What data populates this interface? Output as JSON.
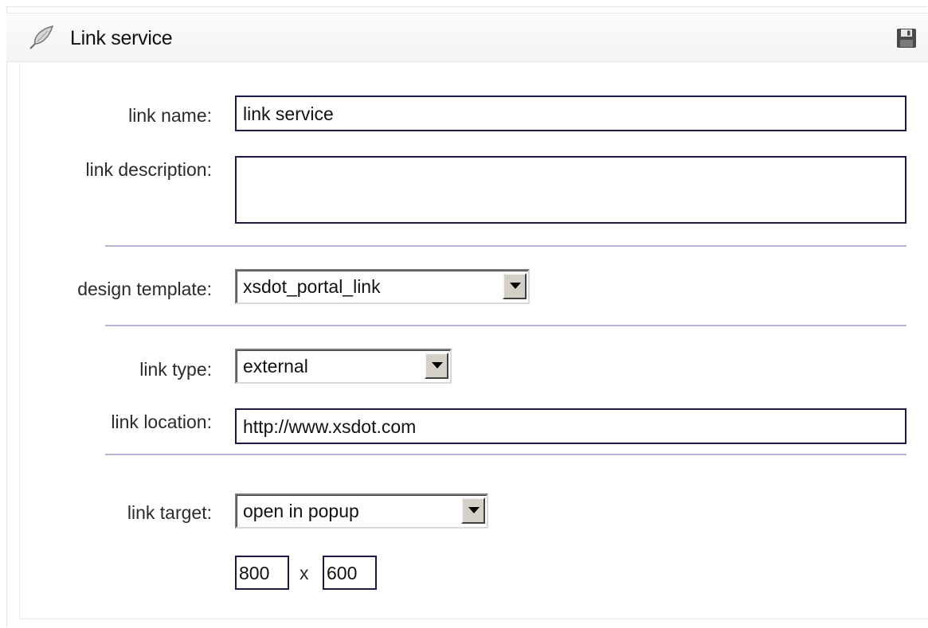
{
  "panel": {
    "title": "Link service",
    "header_icon": "feather-icon",
    "save_icon": "floppy-disk-icon"
  },
  "form": {
    "link_name": {
      "label": "link name:",
      "value": "link service"
    },
    "link_description": {
      "label": "link description:",
      "value": ""
    },
    "design_template": {
      "label": "design template:",
      "selected": "xsdot_portal_link"
    },
    "link_type": {
      "label": "link type:",
      "selected": "external"
    },
    "link_location": {
      "label": "link location:",
      "value": "http://www.xsdot.com"
    },
    "link_target": {
      "label": "link target:",
      "selected": "open in popup"
    },
    "popup_size": {
      "width": "800",
      "separator": "x",
      "height": "600"
    }
  },
  "colors": {
    "input_border": "#1a1a46",
    "divider": "#b5b5d3",
    "header_bg": "#f5f5f5"
  }
}
